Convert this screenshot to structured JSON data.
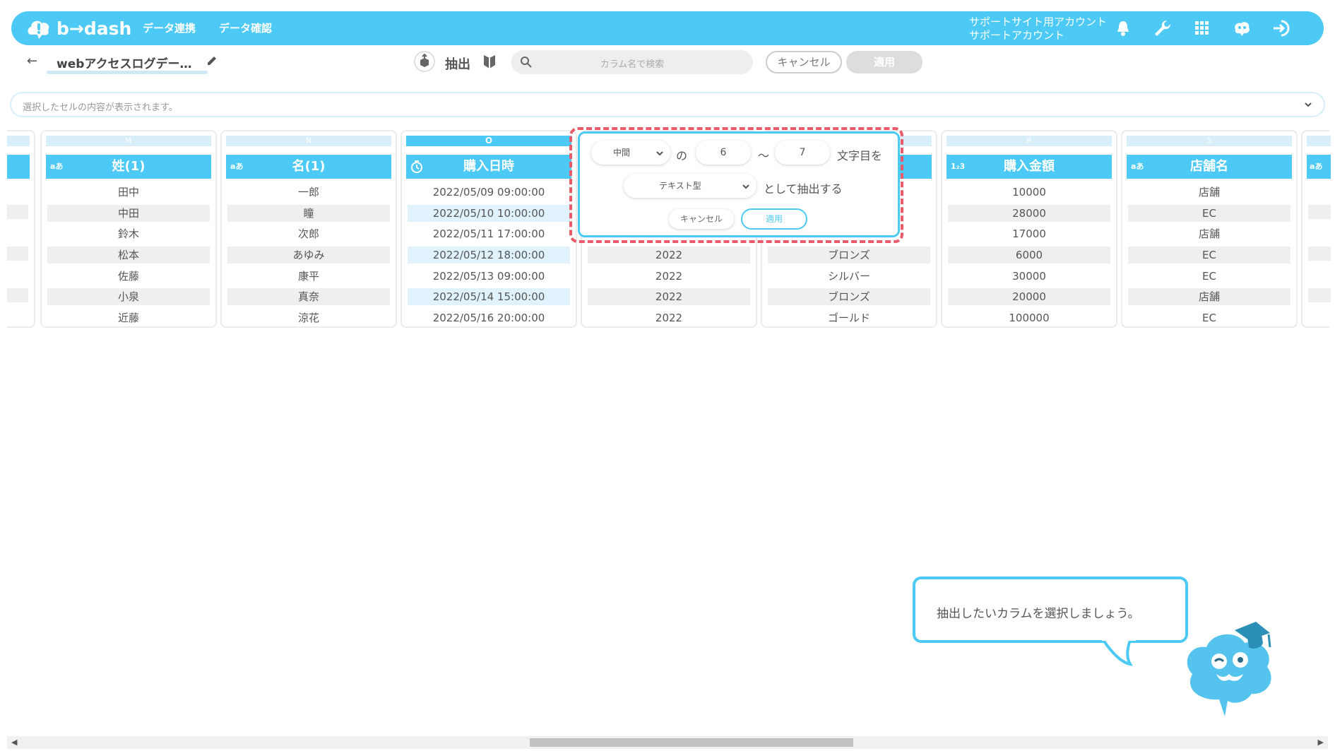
{
  "header": {
    "logo_text": "b→dash",
    "nav": [
      "データ連携",
      "データ確認"
    ],
    "account_line1": "サポートサイト用アカウント",
    "account_line2": "サポートアカウント",
    "icons": [
      "bell-icon",
      "wrench-icon",
      "grid-icon",
      "mascot-icon",
      "logout-icon"
    ]
  },
  "toolbar": {
    "back": "←",
    "dataset_name": "webアクセスログデー…",
    "extract_label": "抽出",
    "search_placeholder": "カラム名で検索",
    "cancel": "キャンセル",
    "apply": "適用"
  },
  "cell_content": {
    "placeholder": "選択したセルの内容が表示されます。"
  },
  "columns": [
    {
      "letter": "M",
      "type": "aあ",
      "name": "姓(1)",
      "cells": [
        "田中",
        "中田",
        "鈴木",
        "松本",
        "佐藤",
        "小泉",
        "近藤"
      ]
    },
    {
      "letter": "N",
      "type": "aあ",
      "name": "名(1)",
      "cells": [
        "一郎",
        "瞳",
        "次郎",
        "あゆみ",
        "康平",
        "真奈",
        "涼花"
      ]
    },
    {
      "letter": "O",
      "type": "clock",
      "name": "購入日時",
      "cells": [
        "2022/05/09 09:00:00",
        "2022/05/10 10:00:00",
        "2022/05/11 17:00:00",
        "2022/05/12 18:00:00",
        "2022/05/13 09:00:00",
        "2022/05/14 15:00:00",
        "2022/05/16 20:00:00"
      ]
    },
    {
      "letter": "",
      "type": "",
      "name": "",
      "cells": [
        "",
        "",
        "",
        "2022",
        "2022",
        "2022",
        "2022"
      ]
    },
    {
      "letter": "",
      "type": "",
      "name": "",
      "cells": [
        "",
        "",
        "",
        "ブロンズ",
        "シルバー",
        "ブロンズ",
        "ゴールド"
      ]
    },
    {
      "letter": "R",
      "type": "1₂3",
      "name": "購入金額",
      "cells": [
        "10000",
        "28000",
        "17000",
        "6000",
        "30000",
        "20000",
        "100000"
      ]
    },
    {
      "letter": "S",
      "type": "aあ",
      "name": "店舗名",
      "cells": [
        "店舗",
        "EC",
        "店舗",
        "EC",
        "EC",
        "店舗",
        "EC"
      ]
    }
  ],
  "popover": {
    "position_select": "中間",
    "no": "の",
    "from": "6",
    "tilde": "〜",
    "to": "7",
    "chars_label": "文字目を",
    "type_select": "テキスト型",
    "as_label": "として抽出する",
    "cancel": "キャンセル",
    "apply": "適用"
  },
  "tip": {
    "text": "抽出したいカラムを選択しましょう。"
  },
  "colors": {
    "accent": "#4ccaf5",
    "highlight": "#e95b6b"
  }
}
